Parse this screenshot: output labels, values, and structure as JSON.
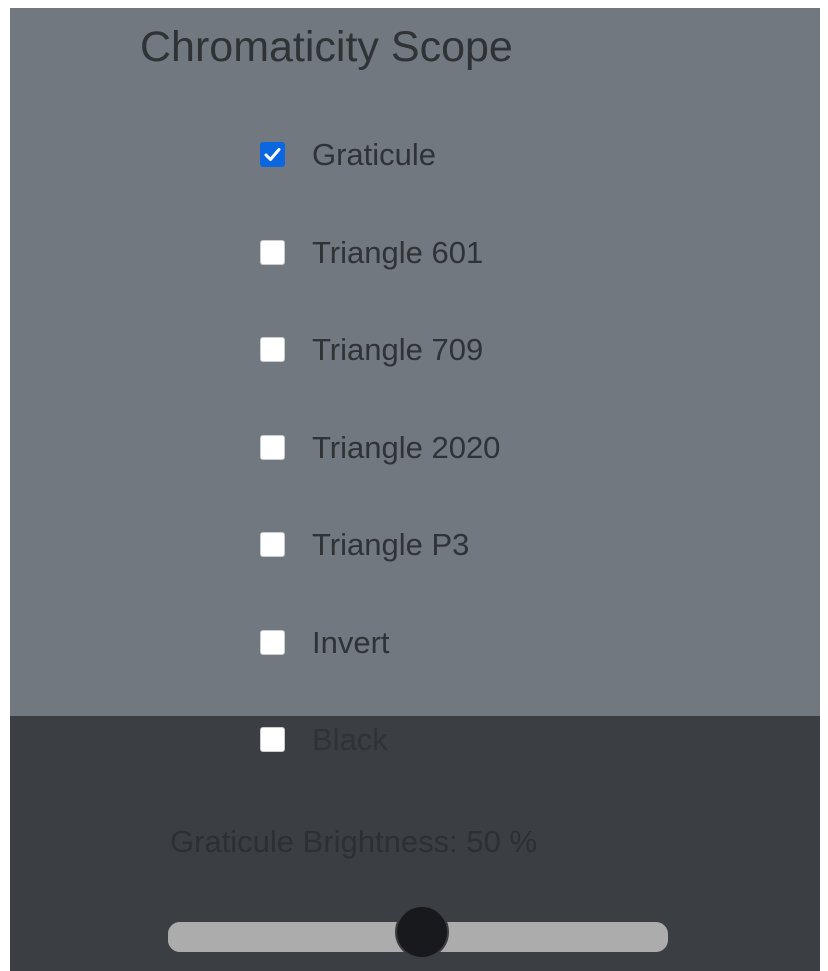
{
  "colors": {
    "panel_top_bg": "#717880",
    "panel_bottom_bg": "#3b3e43",
    "text": "#2f3336",
    "checkbox_checked_bg": "#0b67e0",
    "caption_text": "#2c2f33",
    "track": "#acacac",
    "thumb": "#17191c",
    "thumb_border": "#3a3d41"
  },
  "panel": {
    "title": "Chromaticity Scope"
  },
  "options": [
    {
      "label": "Graticule",
      "checked": true
    },
    {
      "label": "Triangle 601",
      "checked": false
    },
    {
      "label": "Triangle 709",
      "checked": false
    },
    {
      "label": "Triangle 2020",
      "checked": false
    },
    {
      "label": "Triangle P3",
      "checked": false
    },
    {
      "label": "Invert",
      "checked": false
    },
    {
      "label": "Black",
      "checked": false
    }
  ],
  "brightness": {
    "caption": "Graticule Brightness: 50 %",
    "value_percent": 50
  }
}
